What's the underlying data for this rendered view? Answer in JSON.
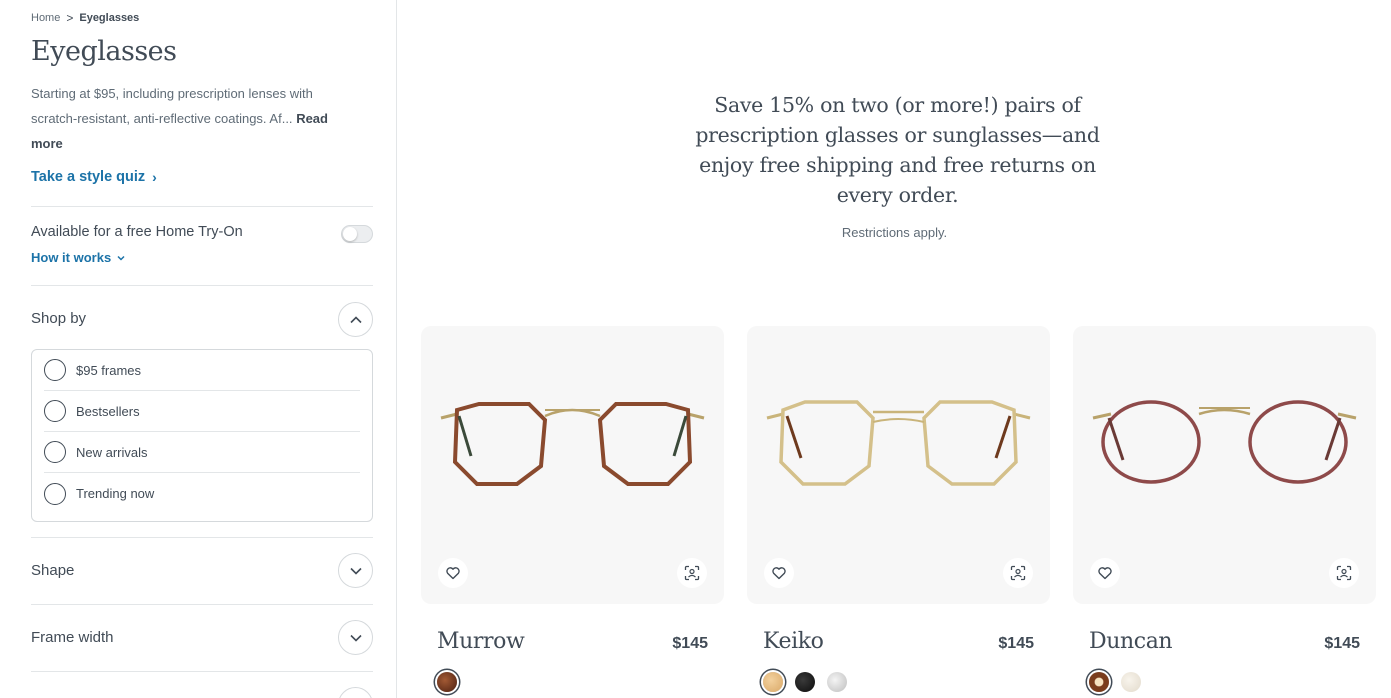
{
  "breadcrumb": {
    "home": "Home",
    "separator": ">",
    "current": "Eyeglasses"
  },
  "page": {
    "title": "Eyeglasses",
    "intro": "Starting at $95, including prescription lenses with scratch-resistant, anti-reflective coatings. Af...",
    "read_more": "Read more",
    "quiz_link": "Take a style quiz",
    "quiz_chevron": "›"
  },
  "home_try_on": {
    "label": "Available for a free Home Try-On",
    "enabled": false,
    "how_link": "How it works",
    "how_chevron": "⌄"
  },
  "filters": {
    "shop_by": {
      "label": "Shop by",
      "expanded": true,
      "options": [
        "$95 frames",
        "Bestsellers",
        "New arrivals",
        "Trending now"
      ]
    },
    "shape": {
      "label": "Shape",
      "expanded": false
    },
    "frame_width": {
      "label": "Frame width",
      "expanded": false
    }
  },
  "promo": {
    "text": "Save 15% on two (or more!) pairs of prescription glasses or sunglasses—and enjoy free shipping and free returns on every order.",
    "restrictions": "Restrictions apply."
  },
  "products": [
    {
      "name": "Murrow",
      "price": "$145",
      "frame_color": "#8a4a2e",
      "swatches": [
        "#6e3520"
      ]
    },
    {
      "name": "Keiko",
      "price": "$145",
      "frame_color": "#d4c08a",
      "swatches": [
        "#e9c48c",
        "#1c1c1c",
        "#d9d9d9"
      ]
    },
    {
      "name": "Duncan",
      "price": "$145",
      "frame_color": "#8e4a4a",
      "swatches": [
        "#5a2e1c",
        "#efe9e0"
      ]
    }
  ],
  "icons": {
    "favorite": "heart-icon",
    "try_on": "face-scan-icon",
    "expand": "chevron-down-icon",
    "collapse": "chevron-up-icon"
  },
  "colors": {
    "link": "#1c73a8",
    "text": "#414b56",
    "card_bg": "#f7f7f7"
  }
}
